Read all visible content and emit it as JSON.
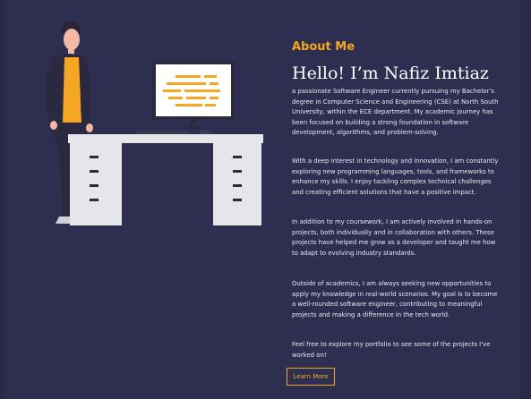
{
  "about": {
    "label": "About Me",
    "headline": "Hello! I’m Nafiz Imtiaz",
    "paragraphs": [
      "a passionate Software Engineer currently pursuing my Bachelor’s degree in Computer Science and Engineering (CSE) at North South University, within the ECE department. My academic journey has been focused on building a strong foundation in software development, algorithms, and problem-solving.",
      "With a deep interest in technology and innovation, I am constantly exploring new programming languages, tools, and frameworks to enhance my skills. I enjoy tackling complex technical challenges and creating efficient solutions that have a positive impact.",
      "In addition to my coursework, I am actively involved in hands-on projects, both individually and in collaboration with others. These projects have helped me grow as a developer and taught me how to adapt to evolving industry standards.",
      "Outside of academics, I am always seeking new opportunities to apply my knowledge in real-world scenarios. My goal is to become a well-rounded software engineer, contributing to meaningful projects and making a difference in the tech world.",
      "Feel free to explore my portfolio to see some of the projects I've worked on!"
    ],
    "button_label": "Learn More"
  },
  "colors": {
    "accent": "#f5a623",
    "background": "#2e2f50",
    "text": "#e9e9f2"
  },
  "illustration": {
    "icon": "developer-at-desk-illustration"
  }
}
